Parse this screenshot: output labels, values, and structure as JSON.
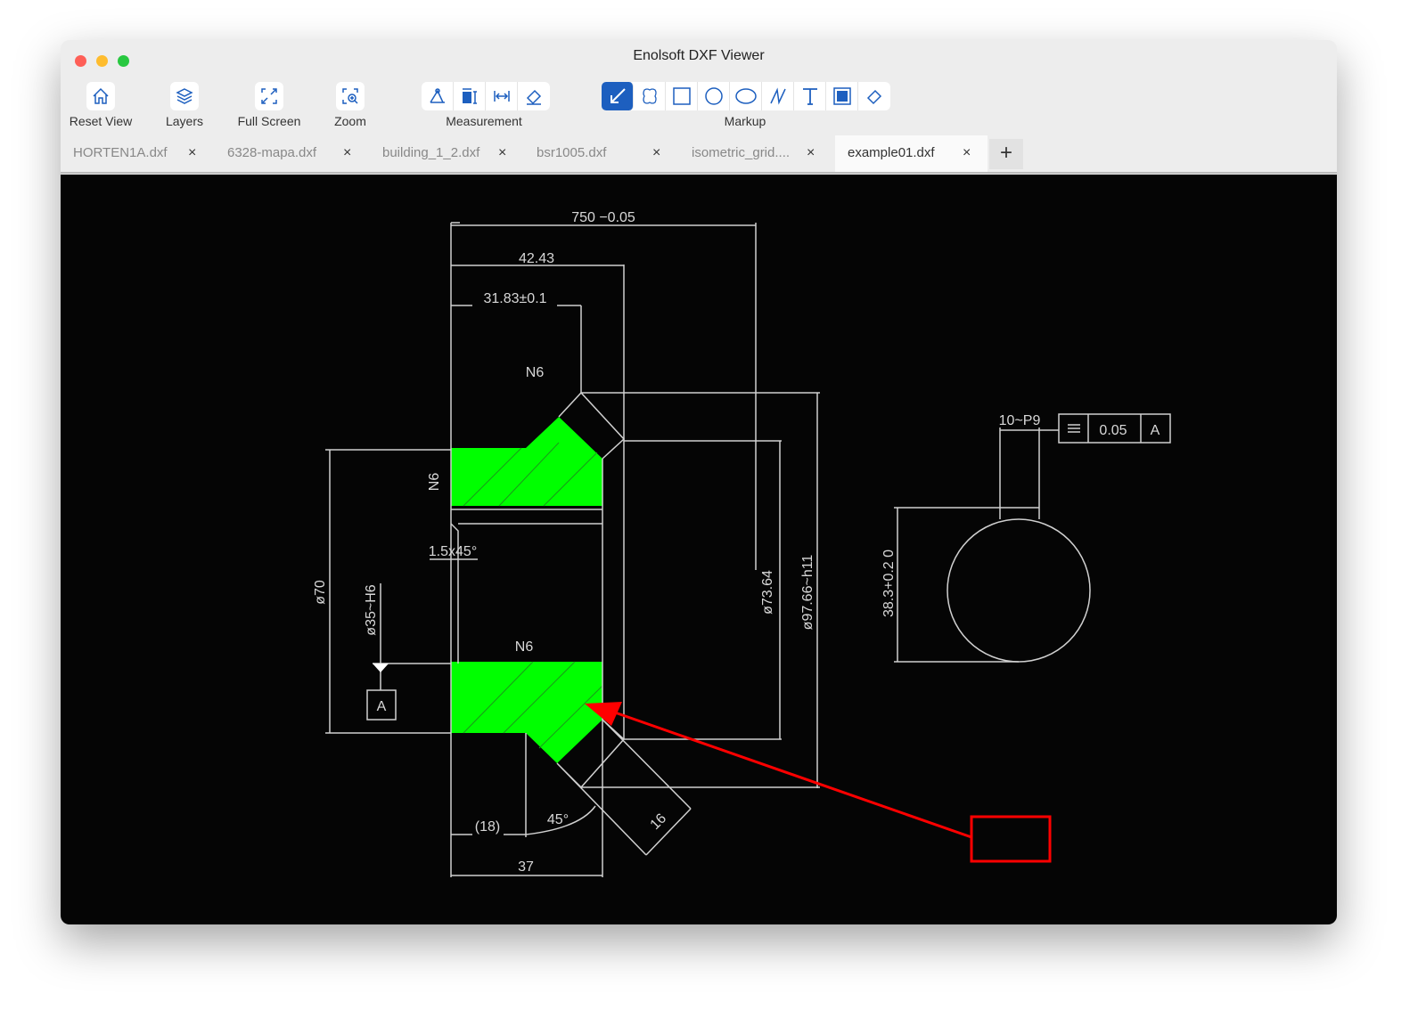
{
  "window": {
    "title": "Enolsoft DXF Viewer"
  },
  "toolbar": {
    "reset_view": "Reset View",
    "layers": "Layers",
    "full_screen": "Full Screen",
    "zoom": "Zoom",
    "measurement_label": "Measurement",
    "markup_label": "Markup",
    "measurement_tools": [
      "angle-icon",
      "area-icon",
      "distance-icon",
      "eraser-icon"
    ],
    "markup_tools": [
      "arrow-icon",
      "cloud-icon",
      "rectangle-icon",
      "circle-icon",
      "ellipse-icon",
      "polyline-icon",
      "text-icon",
      "filled-rectangle-icon",
      "eraser-icon"
    ],
    "accent": "#1d5fbf"
  },
  "tabs": [
    {
      "label": "HORTEN1A.dxf",
      "close": "×"
    },
    {
      "label": "6328-mapa.dxf",
      "close": "×"
    },
    {
      "label": "building_1_2.dxf",
      "close": "×"
    },
    {
      "label": "bsr1005.dxf",
      "close": "×"
    },
    {
      "label": "isometric_grid....",
      "close": "×"
    },
    {
      "label": "example01.dxf",
      "close": "×",
      "active": true
    }
  ],
  "new_tab": "+",
  "drawing": {
    "dims": {
      "d750": "750 −0.05",
      "d4243": "42.43",
      "d3183": "31.83±0.1",
      "chamfer": "1.5x45°",
      "d70": "ø70",
      "d35": "ø35~H6",
      "d7364": "ø73.64",
      "d9766": "ø97.66~h11",
      "d18": "(18)",
      "angle": "45°",
      "d37": "37",
      "d16": "16",
      "keyway": "10~P9",
      "height": "38.3+0.2 0"
    },
    "roughness": "N6",
    "datum": "A",
    "tolerance_frame": {
      "symbol": "symmetry",
      "value": "0.05",
      "datum": "A"
    },
    "fill_color": "#00ff00",
    "markup_color": "#ff0000"
  }
}
